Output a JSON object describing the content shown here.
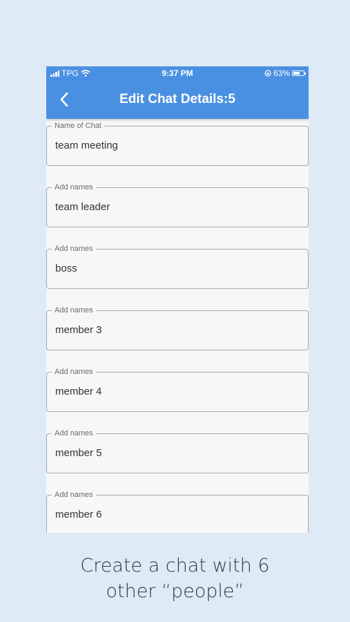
{
  "status_bar": {
    "carrier": "TPG",
    "time": "9:37 PM",
    "battery_percent": "63%",
    "battery_level": 0.63,
    "icons": [
      "signal-icon",
      "wifi-icon",
      "orientation-lock-icon",
      "battery-icon"
    ]
  },
  "app_bar": {
    "title": "Edit Chat Details:5",
    "back_icon": "chevron-left-icon",
    "color": "#4a90e2"
  },
  "fields": [
    {
      "label": "Name of Chat",
      "value": "team meeting"
    },
    {
      "label": "Add names",
      "value": "team leader"
    },
    {
      "label": "Add names",
      "value": "boss"
    },
    {
      "label": "Add names",
      "value": "member 3"
    },
    {
      "label": "Add names",
      "value": "member 4"
    },
    {
      "label": "Add names",
      "value": "member 5"
    },
    {
      "label": "Add names",
      "value": "member 6"
    }
  ],
  "caption": {
    "line1": "Create a chat with 6",
    "line2": "other “people”"
  },
  "colors": {
    "background": "#deeaf6",
    "accent": "#4a90e2",
    "surface": "#f7f7f7"
  }
}
